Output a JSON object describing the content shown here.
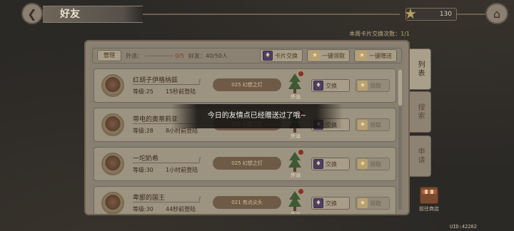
{
  "header": {
    "title": "好友",
    "star_count": "130",
    "exchange_count_label": "本周卡片交换次数：",
    "exchange_count_value": "1/1"
  },
  "toolbar": {
    "manage_label": "管理",
    "dispatch_label": "外派：",
    "dispatch_value": "0/5",
    "friends_label": "好友：40/50人",
    "card_exchange_label": "卡片交换",
    "claim_all_label": "一键领取",
    "gift_all_label": "一键赠送"
  },
  "friends": [
    {
      "name": "红胡子伊格纳兹",
      "level": "等级:25",
      "login": "15秒前登陆",
      "card": "025 幻想之灯",
      "dispatch": "外派",
      "exchange": "交换",
      "claim": "领取"
    },
    {
      "name": "带电的奥蒂莉亚",
      "level": "等级:28",
      "login": "8小时前登陆",
      "card": "025 幻想之灯",
      "dispatch": "外派",
      "exchange": "交换",
      "claim": "领取"
    },
    {
      "name": "一坨奶希",
      "level": "等级:30",
      "login": "1小时前登陆",
      "card": "025 幻想之灯",
      "dispatch": "外派",
      "exchange": "交换",
      "claim": "领取"
    },
    {
      "name": "卑鄙的国王",
      "level": "等级:30",
      "login": "44秒前登陆",
      "card": "021 有点尖头",
      "dispatch": "外派",
      "exchange": "交换",
      "claim": "领取"
    }
  ],
  "side_tabs": [
    "列表",
    "搜索",
    "申请"
  ],
  "shop_label": "前往商店",
  "uid": "UID:42202",
  "toast": "今日的友情点已经赠送过了哦~",
  "icons": {
    "back": "back-arrow-icon",
    "home": "home-icon",
    "star": "star-icon",
    "card": "card-icon",
    "tree": "christmas-tree-icon",
    "shop": "shop-icon"
  }
}
